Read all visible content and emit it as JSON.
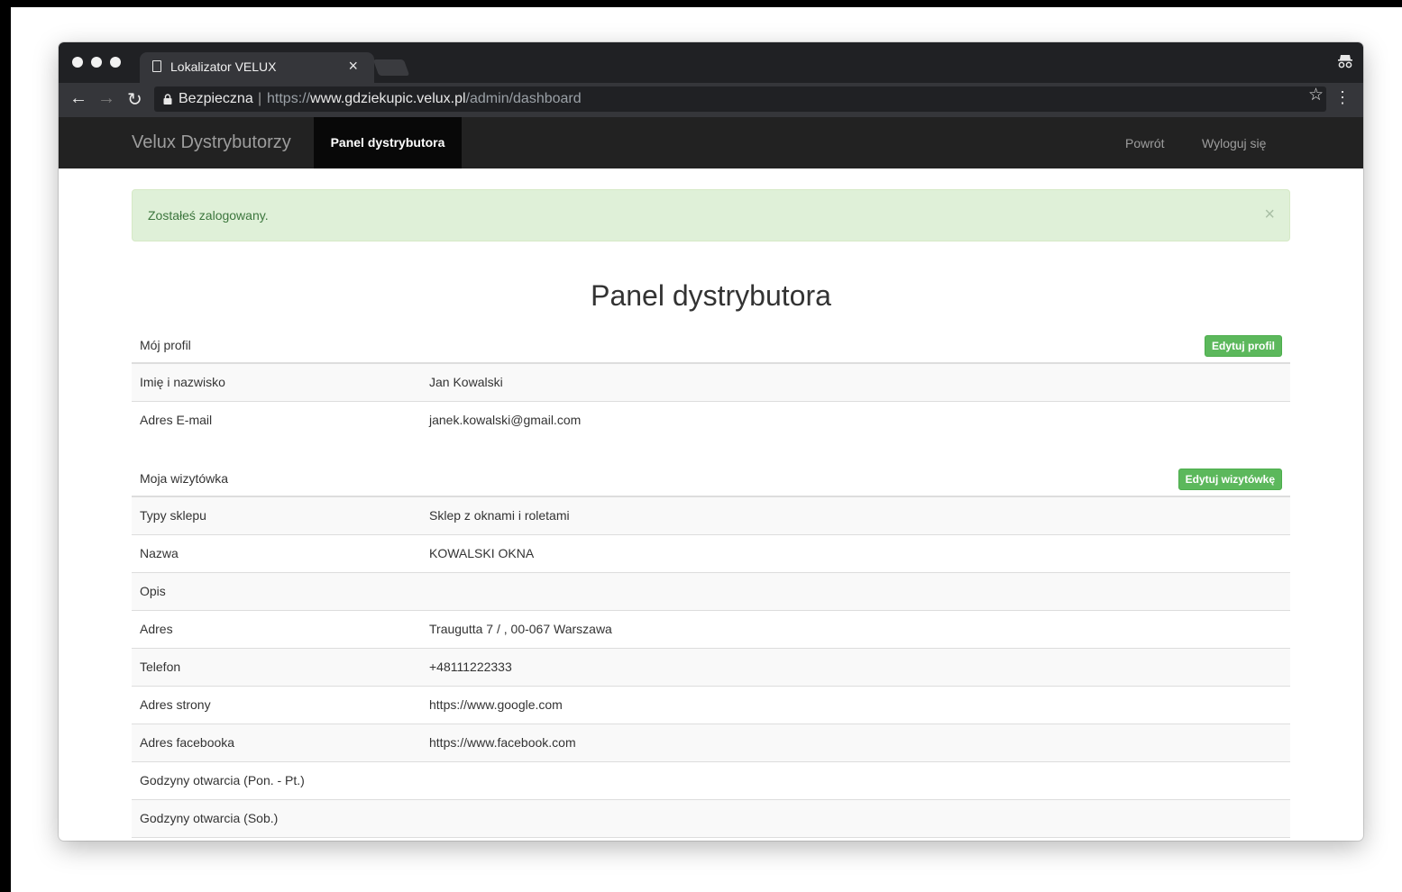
{
  "browser": {
    "tab_title": "Lokalizator VELUX",
    "tab_close": "×",
    "security_label": "Bezpieczna",
    "url_scheme": "https://",
    "url_host": "www.gdziekupic.velux.pl",
    "url_path": "/admin/dashboard"
  },
  "navbar": {
    "brand": "Velux Dystrybutorzy",
    "active_item": "Panel dystrybutora",
    "links": [
      "Powrót",
      "Wyloguj się"
    ]
  },
  "alert": {
    "message": "Zostałeś zalogowany.",
    "close": "×",
    "color": "#dff0d8"
  },
  "page": {
    "title": "Panel dystrybutora"
  },
  "profile": {
    "heading": "Mój profil",
    "edit_label": "Edytuj profil",
    "rows": [
      {
        "label": "Imię i nazwisko",
        "value": "Jan Kowalski"
      },
      {
        "label": "Adres E-mail",
        "value": "janek.kowalski@gmail.com"
      }
    ]
  },
  "card": {
    "heading": "Moja wizytówka",
    "edit_label": "Edytuj wizytówkę",
    "rows": [
      {
        "label": "Typy sklepu",
        "value": "Sklep z oknami i roletami"
      },
      {
        "label": "Nazwa",
        "value": "KOWALSKI OKNA"
      },
      {
        "label": "Opis",
        "value": ""
      },
      {
        "label": "Adres",
        "value": "Traugutta 7 / , 00-067 Warszawa"
      },
      {
        "label": "Telefon",
        "value": "+48111222333"
      },
      {
        "label": "Adres strony",
        "value": "https://www.google.com"
      },
      {
        "label": "Adres facebooka",
        "value": "https://www.facebook.com"
      },
      {
        "label": "Godzyny otwarcia (Pon. - Pt.)",
        "value": ""
      },
      {
        "label": "Godzyny otwarcia (Sob.)",
        "value": ""
      }
    ]
  },
  "colors": {
    "button_green": "#5cb85c",
    "navbar_bg": "#222222",
    "alert_text": "#3c763d"
  },
  "icons": [
    "document-icon",
    "close-icon",
    "incognito-icon",
    "back-icon",
    "forward-icon",
    "reload-icon",
    "lock-icon",
    "star-icon",
    "menu-icon"
  ]
}
